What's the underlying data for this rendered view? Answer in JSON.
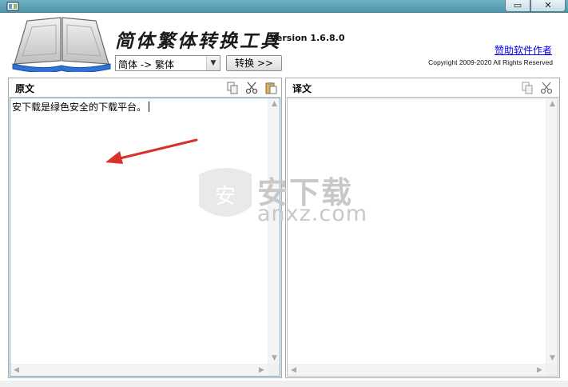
{
  "window": {
    "minimize_glyph": "▭",
    "close_glyph": "✕"
  },
  "header": {
    "title": "简体繁体转换工具",
    "version": "Version 1.6.8.0",
    "sponsor_link": "赞助软件作者",
    "copyright": "Copyright 2009-2020 All Rights Reserved"
  },
  "controls": {
    "mode_value": "简体 -> 繁体",
    "convert_label": "转换 >>"
  },
  "source_panel": {
    "title": "原文",
    "text": "安下载是绿色安全的下载平台。",
    "tools": [
      "copy-icon",
      "cut-icon",
      "paste-icon"
    ]
  },
  "target_panel": {
    "title": "译文",
    "text": "",
    "tools": [
      "copy-icon",
      "cut-icon"
    ]
  },
  "watermark": {
    "text": "安下载",
    "domain": "anxz.com",
    "shield_char": "安"
  },
  "colors": {
    "titlebar": "#5fa3b7",
    "annotation_arrow": "#d9302a",
    "link": "#0000ee"
  }
}
